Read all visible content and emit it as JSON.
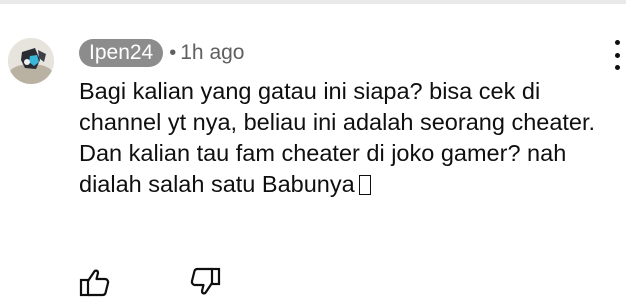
{
  "comment": {
    "author": "Ipen24",
    "separator": "•",
    "timestamp": "1h ago",
    "text": "Bagi kalian yang gatau ini siapa? bisa cek di channel yt nya, beliau ini adalah seorang cheater. Dan kalian tau fam cheater di joko gamer? nah dialah salah satu Babunya"
  },
  "icons": {
    "avatar": "avatar-image",
    "more": "more-vertical-icon",
    "like": "thumbs-up-icon",
    "dislike": "thumbs-down-icon",
    "emoji": "missing-glyph-box"
  },
  "colors": {
    "author_chip_bg": "#8c8c8c",
    "secondary_text": "#606060",
    "primary_text": "#0f0f0f"
  }
}
